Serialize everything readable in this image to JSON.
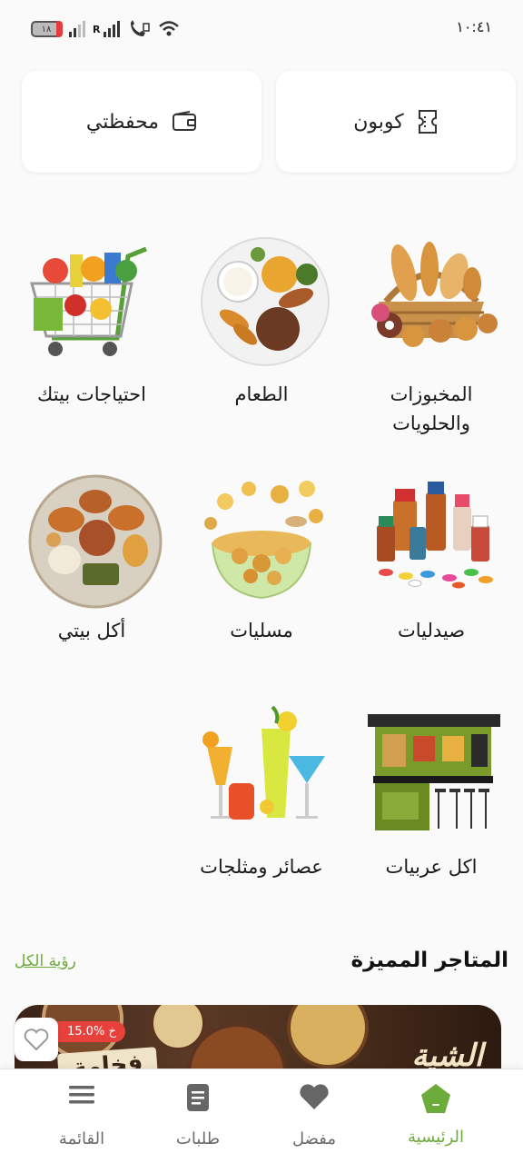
{
  "status_bar": {
    "time": "١٠:٤١",
    "battery": "١٨"
  },
  "top_cards": {
    "coupon": {
      "label": "كوبون",
      "icon": "coupon-icon"
    },
    "wallet": {
      "label": "محفظتي",
      "icon": "wallet-icon"
    }
  },
  "categories": [
    {
      "label": "المخبوزات والحلويات",
      "image": "bakery-basket"
    },
    {
      "label": "الطعام",
      "image": "food-plate"
    },
    {
      "label": "احتياجات بيتك",
      "image": "shopping-cart"
    },
    {
      "label": "صيدليات",
      "image": "medicine-bottles"
    },
    {
      "label": "مسليات",
      "image": "snacks-bowl"
    },
    {
      "label": "أكل بيتي",
      "image": "home-food-tray"
    },
    {
      "label": "اكل عربيات",
      "image": "food-kiosk"
    },
    {
      "label": "عصائر ومثلجات",
      "image": "juice-glasses"
    }
  ],
  "featured": {
    "title": "المتاجر المميزة",
    "see_all": "رؤية الكل",
    "store": {
      "discount": "15.0% خ",
      "name_text": "الشية",
      "sign_text": "فخامة"
    }
  },
  "bottom_nav": {
    "items": [
      {
        "label": "الرئيسية",
        "icon": "home-icon",
        "active": true
      },
      {
        "label": "مفضل",
        "icon": "heart-icon",
        "active": false
      },
      {
        "label": "طلبات",
        "icon": "orders-icon",
        "active": false
      },
      {
        "label": "القائمة",
        "icon": "menu-icon",
        "active": false
      }
    ]
  },
  "colors": {
    "accent": "#6dab3b",
    "discount": "#e8413b",
    "background": "#fafafa"
  }
}
